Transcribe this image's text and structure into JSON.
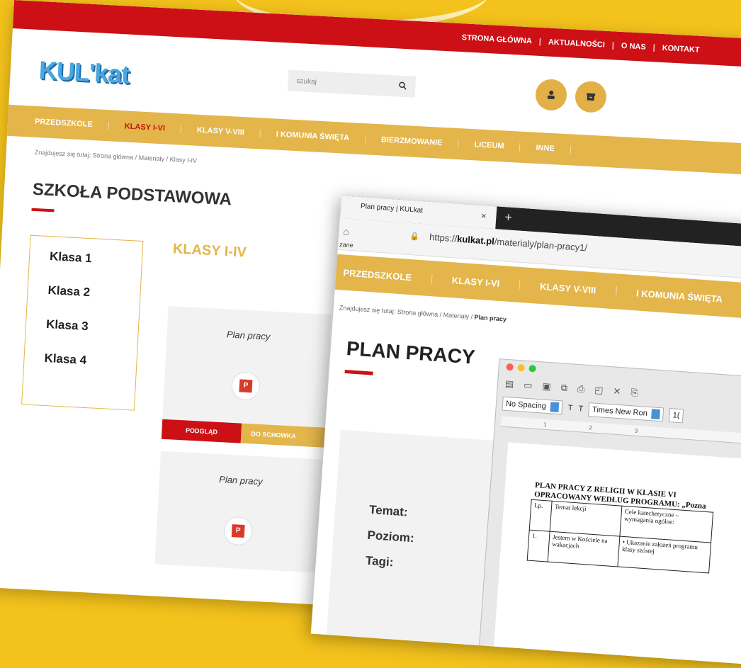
{
  "site": {
    "logo": "KUL'kat",
    "top_links": [
      "STRONA GŁÓWNA",
      "AKTUALNOŚCI",
      "O NAS",
      "KONTAKT"
    ],
    "top_sep": "|",
    "search_placeholder": "szukaj",
    "nav": [
      "PRZEDSZKOLE",
      "KLASY I-VI",
      "KLASY V-VIII",
      "I KOMUNIA ŚWIĘTA",
      "BIERZMOWANIE",
      "LICEUM",
      "INNE"
    ],
    "nav_active": "KLASY I-VI",
    "breadcrumb": "Znajdujesz się tutaj: Strona główna / Materiały / Klasy I-IV",
    "heading": "SZKOŁA PODSTAWOWA",
    "sidebar": [
      "Klasa 1",
      "Klasa 2",
      "Klasa 3",
      "Klasa 4"
    ],
    "section_title": "KLASY I-IV",
    "cards": [
      {
        "title": "Plan pracy",
        "preview": "PODGLĄD",
        "save": "DO SCHOWKA"
      },
      {
        "title": "Plan pracy"
      }
    ]
  },
  "browser": {
    "tab_title": "Plan pracy | KULkat",
    "tab_close": "×",
    "new_tab": "+",
    "url_prefix": "https://",
    "url_domain": "kulkat.pl",
    "url_path": "/materialy/plan-pracy1/",
    "bookmarks_fragment": "zane",
    "nav": [
      "PRZEDSZKOLE",
      "KLASY I-VI",
      "KLASY V-VIII",
      "I KOMUNIA ŚWIĘTA"
    ],
    "breadcrumb_prefix": "Znajdujesz się tutaj: Strona główna / Materiały / ",
    "breadcrumb_current": "Plan pracy",
    "heading": "PLAN PRACY",
    "meta": [
      "Temat:",
      "Poziom:",
      "Tagi:"
    ]
  },
  "word": {
    "style": "No Spacing",
    "font": "Times New Ron",
    "size": "1(",
    "ruler_marks": [
      "1",
      "2",
      "3"
    ],
    "doc_title_line1": "PLAN PRACY Z RELIGII W KLASIE VI",
    "doc_title_line2": "OPRACOWANY WEDŁUG PROGRAMU: „Pozna",
    "table_header": [
      "Lp.",
      "Temat lekcji",
      "Cele katechetyczne – wymagania ogólne:"
    ],
    "table_row1": [
      "1.",
      "Jestem w Kościele na wakacjach",
      "• Ukazanie założeń programu klasy szóstej"
    ]
  },
  "colors": {
    "red": "#cc1016",
    "gold": "#e3b54a",
    "bg": "#f3c21c",
    "logo": "#4aa7e0"
  }
}
